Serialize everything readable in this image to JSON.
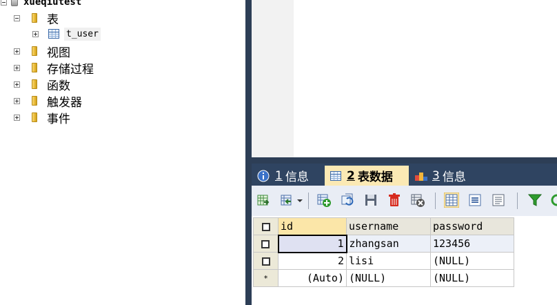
{
  "tree": {
    "db_name": "xueqiutest",
    "tables_label": "表",
    "table_item": "t_user",
    "folders": [
      "视图",
      "存储过程",
      "函数",
      "触发器",
      "事件"
    ]
  },
  "tabs": [
    {
      "num": "1",
      "label": "信息"
    },
    {
      "num": "2",
      "label": "表数据"
    },
    {
      "num": "3",
      "label": "信息"
    }
  ],
  "grid": {
    "columns": [
      "id",
      "username",
      "password"
    ],
    "rows": [
      {
        "marker": "",
        "id": "1",
        "username": "zhangsan",
        "password": "123456"
      },
      {
        "marker": "",
        "id": "2",
        "username": "lisi",
        "password": "(NULL)"
      },
      {
        "marker": "*",
        "id": "(Auto)",
        "username": "(NULL)",
        "password": "(NULL)"
      }
    ]
  },
  "colors": {
    "sidebar_dark": "#2d3e56",
    "active_tab": "#fbe9b4",
    "toolbar_bg": "#e9edf5"
  }
}
